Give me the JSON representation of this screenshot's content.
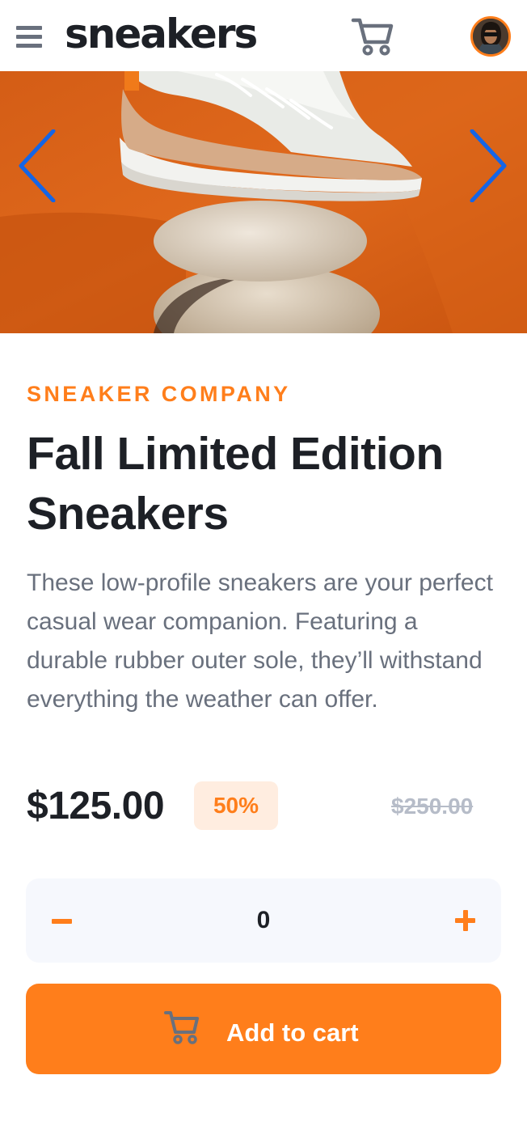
{
  "header": {
    "logo": "sneakers",
    "menu_icon": "hamburger-menu-icon",
    "cart_icon": "cart-icon",
    "avatar_icon": "user-avatar"
  },
  "gallery": {
    "prev_icon": "chevron-left-icon",
    "next_icon": "chevron-right-icon",
    "image": "sneaker-on-stones-photo"
  },
  "product": {
    "company": "SNEAKER COMPANY",
    "title": "Fall Limited Edition Sneakers",
    "description": "These low-profile sneakers are your perfect casual wear companion. Featuring a durable rubber outer sole, they’ll withstand everything the weather can offer.",
    "price": "$125.00",
    "discount": "50%",
    "original_price": "$250.00"
  },
  "quantity": {
    "value": "0",
    "minus_icon": "minus-icon",
    "plus_icon": "plus-icon"
  },
  "add_to_cart": {
    "label": "Add to cart",
    "icon": "cart-icon"
  },
  "colors": {
    "accent": "#ff7e1b",
    "accent_pale": "#ffede0",
    "dark": "#1d2026",
    "text_gray": "#69707d",
    "light_gray": "#b6bcc8",
    "qty_bg": "#f6f8fd",
    "arrow_blue": "#1565e6"
  }
}
